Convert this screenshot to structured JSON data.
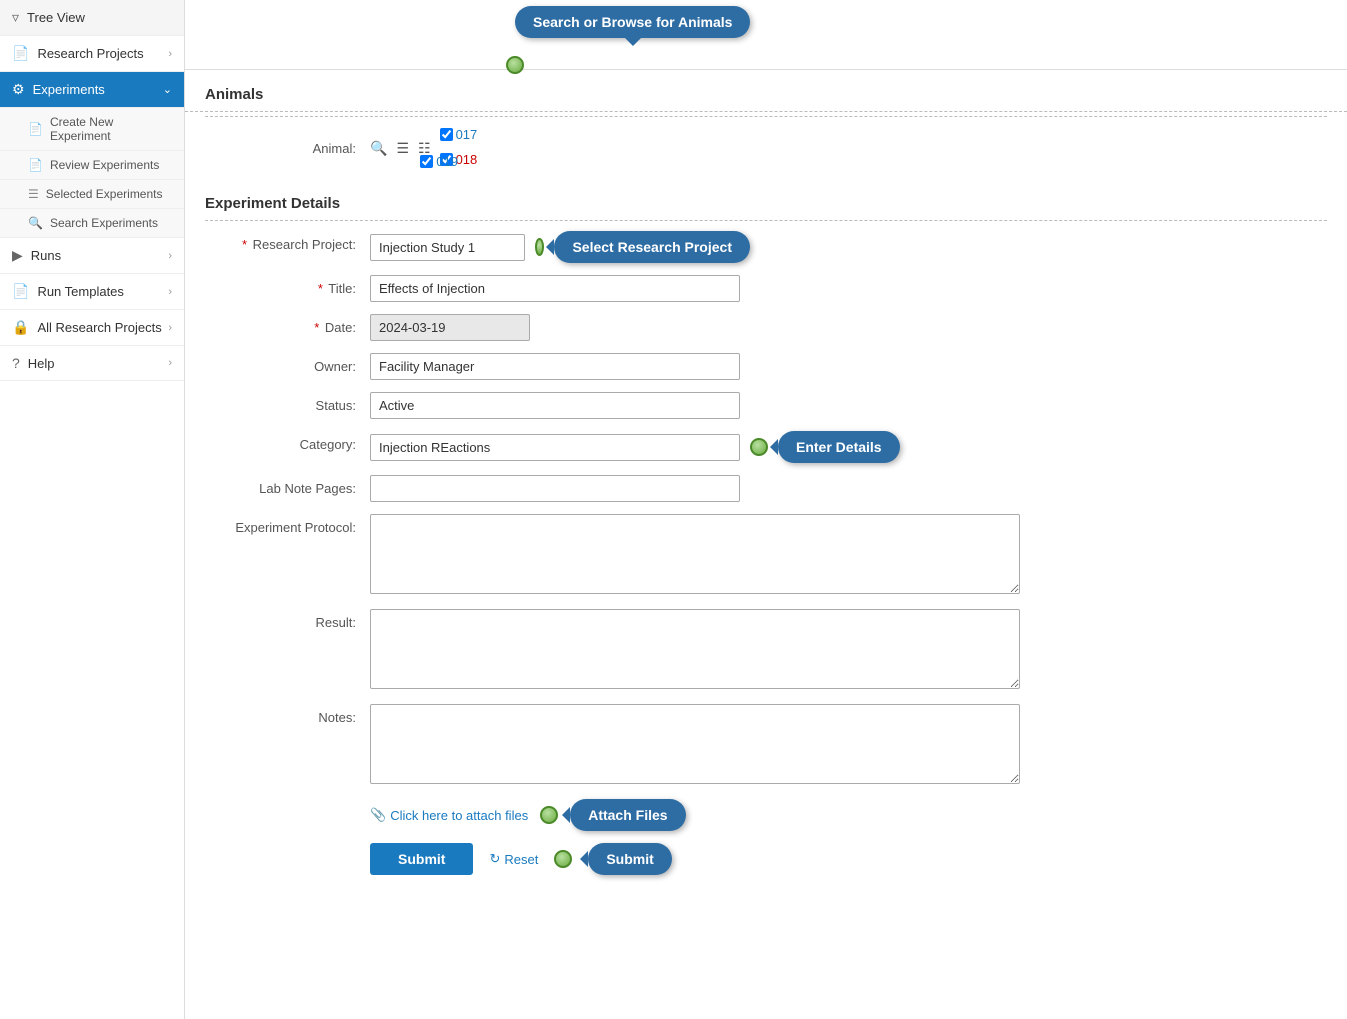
{
  "sidebar": {
    "tree_view": "Tree View",
    "research_projects": "Research Projects",
    "experiments": "Experiments",
    "create_experiment": "Create New Experiment",
    "review_experiments": "Review Experiments",
    "selected_experiments": "Selected Experiments",
    "search_experiments": "Search Experiments",
    "runs": "Runs",
    "run_templates": "Run Templates",
    "all_research_projects": "All Research Projects",
    "help": "Help"
  },
  "tooltips": {
    "search_browse": "Search or Browse for Animals",
    "select_research_project": "Select Research Project",
    "enter_details": "Enter Details",
    "attach_files": "Attach Files",
    "submit": "Submit"
  },
  "animals_section": {
    "header": "Animals",
    "animal_label": "Animal:",
    "animals": [
      {
        "id": "017",
        "checked": true,
        "color": "blue"
      },
      {
        "id": "018",
        "checked": true,
        "color": "red"
      },
      {
        "id": "019",
        "checked": true,
        "color": "blue"
      }
    ]
  },
  "experiment_details": {
    "header": "Experiment Details",
    "research_project_label": "Research Project:",
    "research_project_value": "Injection Study 1",
    "title_label": "Title:",
    "title_value": "Effects of Injection",
    "date_label": "Date:",
    "date_value": "2024-03-19",
    "owner_label": "Owner:",
    "owner_value": "Facility Manager",
    "status_label": "Status:",
    "status_value": "Active",
    "category_label": "Category:",
    "category_value": "Injection REactions",
    "lab_note_label": "Lab Note Pages:",
    "lab_note_value": "",
    "protocol_label": "Experiment Protocol:",
    "protocol_value": "",
    "result_label": "Result:",
    "result_value": "",
    "notes_label": "Notes:",
    "notes_value": ""
  },
  "actions": {
    "attach_text": "Click here to attach files",
    "submit_label": "Submit",
    "reset_label": "Reset"
  }
}
